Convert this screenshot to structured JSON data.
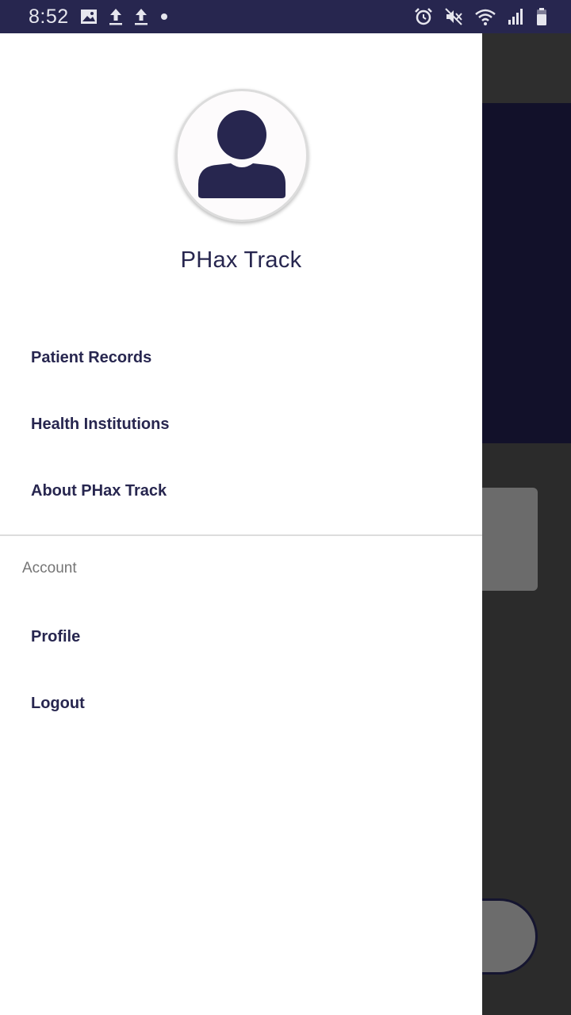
{
  "status_bar": {
    "time": "8:52",
    "left_icons": [
      "image-icon",
      "upload-icon",
      "upload-icon",
      "dot-icon"
    ],
    "right_icons": [
      "alarm-icon",
      "mute-icon",
      "wifi-icon",
      "signal-icon",
      "battery-icon"
    ]
  },
  "drawer": {
    "app_name": "PHax Track",
    "avatar_icon": "person-icon",
    "menu": {
      "patient_records": "Patient Records",
      "health_institutions": "Health Institutions",
      "about": "About PHax Track"
    },
    "account_section": {
      "label": "Account",
      "profile": "Profile",
      "logout": "Logout"
    }
  },
  "colors": {
    "primary": "#27264f",
    "status_bar": "#27264f",
    "drawer_bg": "#ffffff",
    "scrim_bg": "#2b2b2b",
    "hero_bg": "#12112a",
    "section_label": "#757575"
  }
}
